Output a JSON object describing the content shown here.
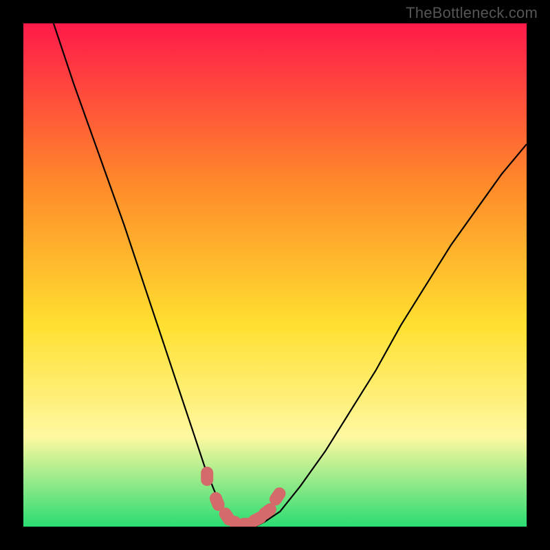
{
  "watermark": "TheBottleneck.com",
  "colors": {
    "frame": "#000000",
    "gradient_top": "#ff1a4a",
    "gradient_mid1": "#ff8a2a",
    "gradient_mid2": "#ffe030",
    "gradient_mid3": "#fff8a0",
    "gradient_bottom": "#2bdc72",
    "curve": "#000000",
    "marker": "#d46a6a"
  },
  "chart_data": {
    "type": "line",
    "title": "",
    "xlabel": "",
    "ylabel": "",
    "xlim": [
      0,
      100
    ],
    "ylim": [
      0,
      100
    ],
    "series": [
      {
        "name": "bottleneck-curve",
        "x": [
          6,
          10,
          15,
          20,
          25,
          28,
          31,
          34,
          36,
          38,
          40,
          42,
          44,
          46,
          48,
          51,
          55,
          60,
          65,
          70,
          75,
          80,
          85,
          90,
          95,
          100
        ],
        "y": [
          100,
          88,
          74,
          60,
          45,
          36,
          27,
          18,
          12,
          7,
          3,
          1,
          0,
          0,
          1,
          3,
          8,
          15,
          23,
          31,
          40,
          48,
          56,
          63,
          70,
          76
        ]
      }
    ],
    "markers": {
      "name": "highlight-near-minimum",
      "x": [
        36.5,
        38.5,
        40.5,
        42.5,
        44.5,
        46.5,
        48.5,
        50.5
      ],
      "y": [
        10,
        5,
        2,
        0.5,
        0.5,
        1.5,
        3,
        6
      ]
    },
    "minimum_x": 44
  }
}
